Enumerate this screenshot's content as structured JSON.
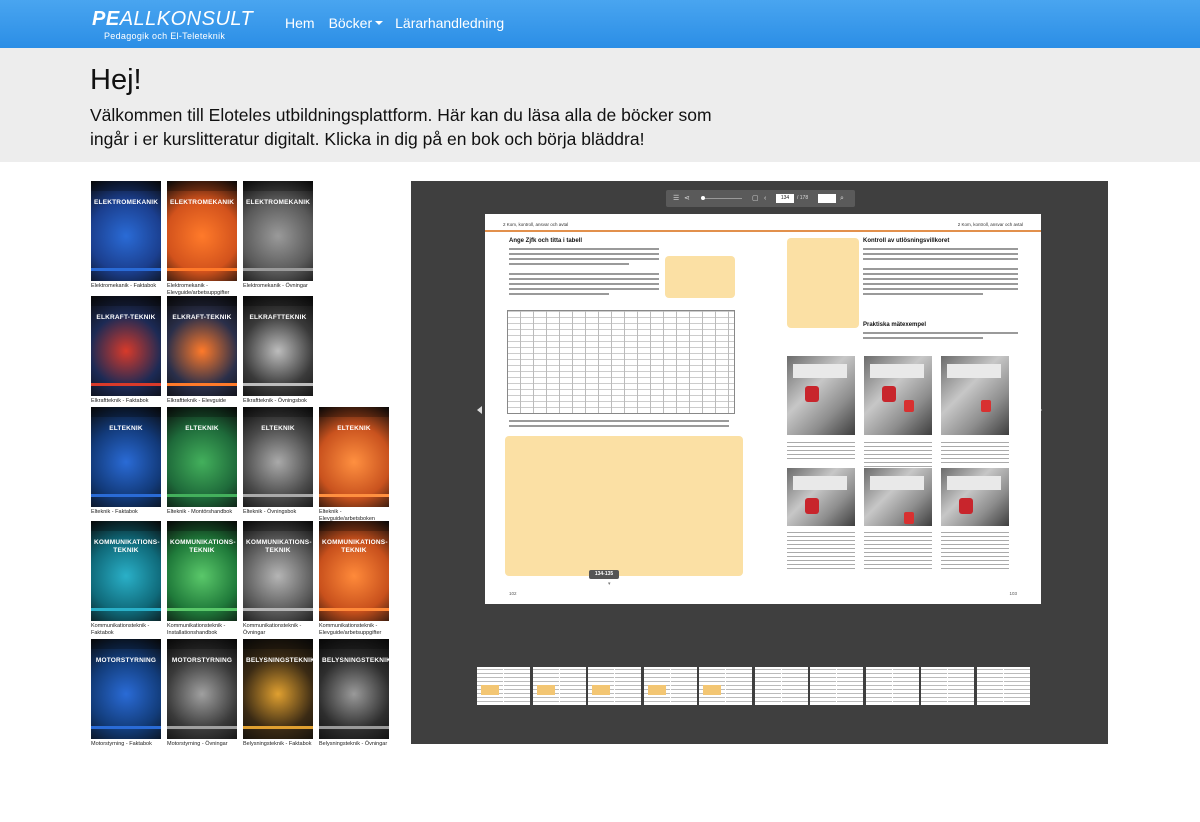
{
  "brand": {
    "logo_bold": "PE",
    "logo_rest": "ALLKONSULT",
    "tagline": "Pedagogik och El-Teleteknik"
  },
  "nav": {
    "home": "Hem",
    "books": "Böcker",
    "teacher": "Lärarhandledning"
  },
  "hero": {
    "title": "Hej!",
    "text": "Välkommen till Eloteles utbildningsplattform. Här kan du läsa alla de böcker som ingår i er kurslitteratur digitalt. Klicka in dig på en bok och börja bläddra!"
  },
  "books": [
    {
      "title": "ELEKTROMEKANIK",
      "label": "Elektromekanik - Faktabok",
      "color": "#1b3f8f",
      "bar": "#2a6bd6"
    },
    {
      "title": "ELEKTROMEKANIK",
      "label": "Elektromekanik - Elevguide/arbetsuppgifter",
      "color": "#d2521c",
      "bar": "#ff7a2a"
    },
    {
      "title": "ELEKTROMEKANIK",
      "label": "Elektromekanik - Övningar",
      "color": "#5a5a5a",
      "bar": "#9a9a9a"
    },
    {
      "title": "ELKRAFT-TEKNIK",
      "label": "Elkraftteknik - Faktabok",
      "color": "#1c2a55",
      "bar": "#d83a2a"
    },
    {
      "title": "ELKRAFT-TEKNIK",
      "label": "Elkraftteknik - Elevguide",
      "color": "#2a2f4a",
      "bar": "#ff7a2a"
    },
    {
      "title": "ELKRAFTTEKNIK",
      "label": "Elkraftteknik - Övningsbok",
      "color": "#3a3a3a",
      "bar": "#bdbdbd"
    },
    {
      "title": "ELTEKNIK",
      "label": "Elteknik - Faktabok",
      "color": "#123a7a",
      "bar": "#2a6bd6"
    },
    {
      "title": "ELTEKNIK",
      "label": "Elteknik - Montörshandbok",
      "color": "#1e6a3a",
      "bar": "#43b05c"
    },
    {
      "title": "ELTEKNIK",
      "label": "Elteknik - Övningsbok",
      "color": "#4a4a4a",
      "bar": "#aaaaaa"
    },
    {
      "title": "ELTEKNIK",
      "label": "Elteknik - Elevguide/arbetsboken",
      "color": "#c9521e",
      "bar": "#ff9040"
    },
    {
      "title": "KOMMUNIKATIONS-TEKNIK",
      "label": "Kommunikationsteknik - Faktabok",
      "color": "#0f6a7a",
      "bar": "#2ab0c8"
    },
    {
      "title": "KOMMUNIKATIONS-TEKNIK",
      "label": "Kommunikationsteknik - Installationshandbok",
      "color": "#1f7a3a",
      "bar": "#5ac86a"
    },
    {
      "title": "KOMMUNIKATIONS-TEKNIK",
      "label": "Kommunikationsteknik - Övningar",
      "color": "#5a5a5a",
      "bar": "#b5b5b5"
    },
    {
      "title": "KOMMUNIKATIONS-TEKNIK",
      "label": "Kommunikationsteknik - Elevguide/arbetsuppgifter",
      "color": "#c8501c",
      "bar": "#ff8a3a"
    },
    {
      "title": "MOTORSTYRNING",
      "label": "Motorstyrning - Faktabok",
      "color": "#123c7a",
      "bar": "#2a6bd6"
    },
    {
      "title": "MOTORSTYRNING",
      "label": "Motorstyrning - Övningar",
      "color": "#3a3a3a",
      "bar": "#a0a0a0"
    },
    {
      "title": "BELYSNINGSTEKNIK",
      "label": "Belysningsteknik - Faktabok",
      "color": "#3a2a14",
      "bar": "#e0a030"
    },
    {
      "title": "BELYSNINGSTEKNIK",
      "label": "Belysningsteknik - Övningar",
      "color": "#2e2e2e",
      "bar": "#9a9a9a"
    }
  ],
  "viewer": {
    "page_input": "134",
    "page_total": "/ 178",
    "left_header": "2 Kom, kontroll, ansvar och avtal",
    "right_header": "2 Kom, kontroll, ansvar och avtal",
    "left_heading": "Ange Zjfk och titta i tabell",
    "right_heading": "Kontroll av utlösningsvillkoret",
    "right_subheading": "Praktiska mätexempel",
    "left_page_num": "102",
    "right_page_num": "103",
    "page_badge": "134-135"
  }
}
